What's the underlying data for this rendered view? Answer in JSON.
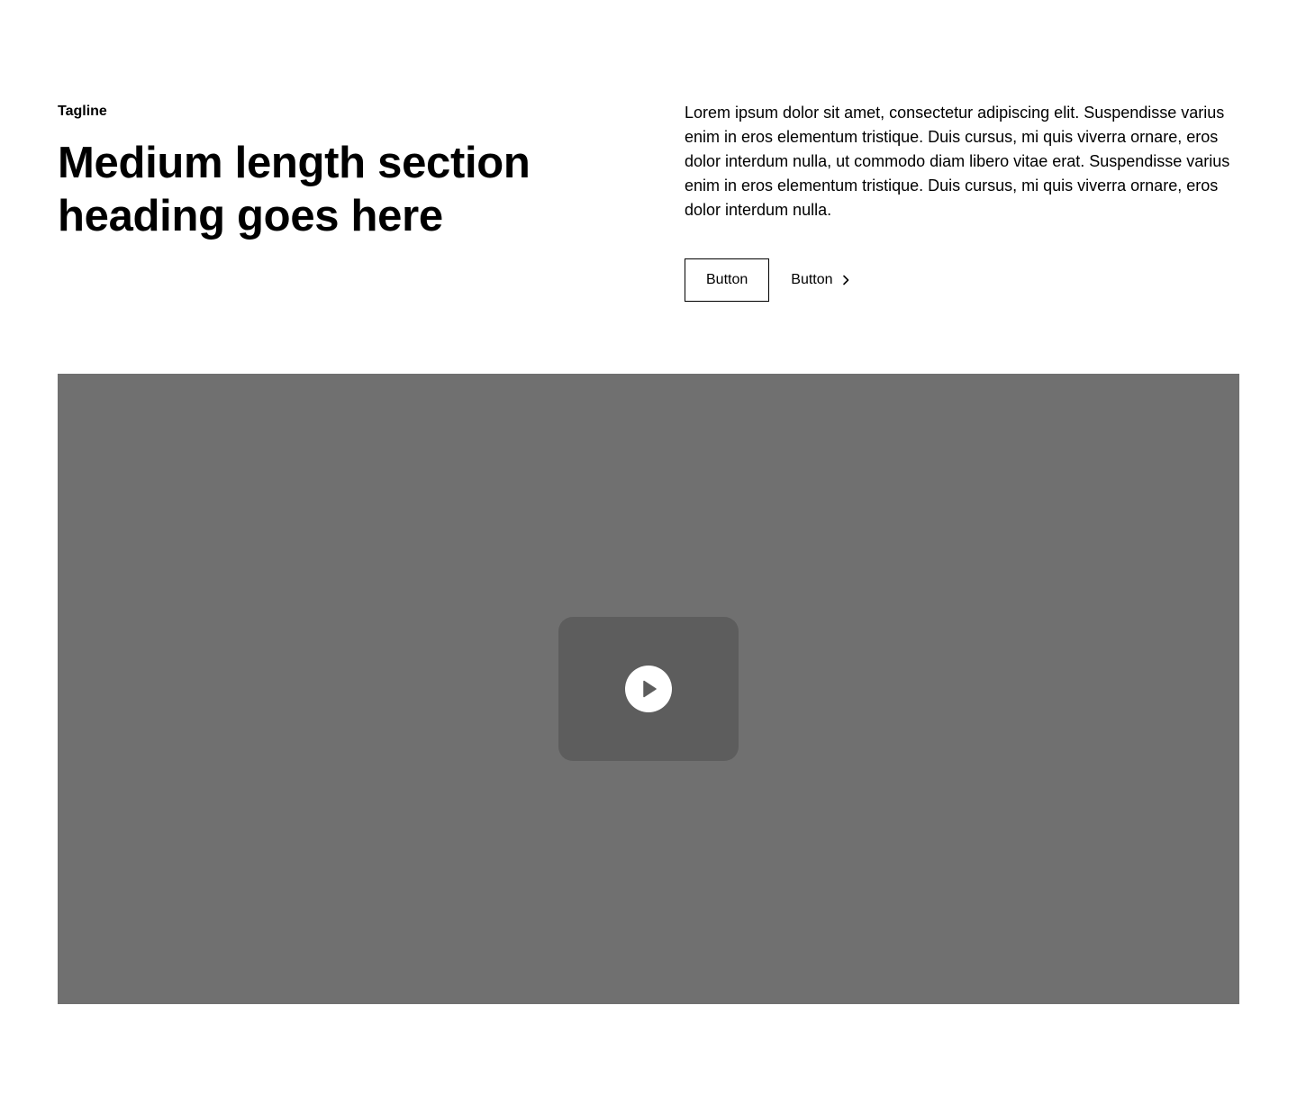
{
  "section": {
    "tagline": "Tagline",
    "heading": "Medium length section heading goes here",
    "body": "Lorem ipsum dolor sit amet, consectetur adipiscing elit. Suspendisse varius enim in eros elementum tristique. Duis cursus, mi quis viverra ornare, eros dolor interdum nulla, ut commodo diam libero vitae erat. Suspendisse varius enim in eros elementum tristique. Duis cursus, mi quis viverra ornare, eros dolor interdum nulla.",
    "primary_button_label": "Button",
    "secondary_button_label": "Button",
    "secondary_button_icon": "chevron-right-icon"
  },
  "media": {
    "icon": "play-icon",
    "background_color": "#707070",
    "play_card_color": "#5d5d5d"
  }
}
